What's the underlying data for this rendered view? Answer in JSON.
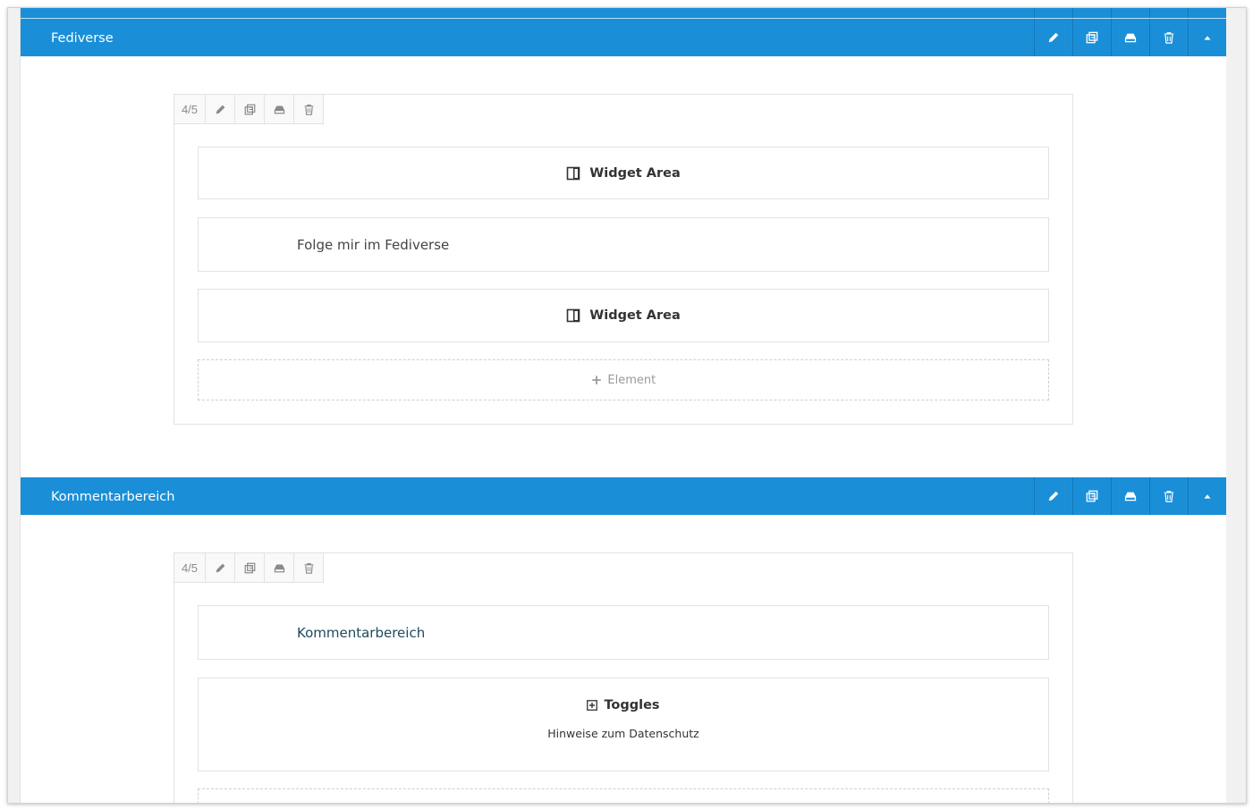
{
  "sections": [
    {
      "title": "Fediverse",
      "column": {
        "size_label": "4/5",
        "elements": [
          {
            "type": "widget-area",
            "label": "Widget Area"
          },
          {
            "type": "text",
            "label": "Folge mir im Fediverse"
          },
          {
            "type": "widget-area",
            "label": "Widget Area"
          }
        ],
        "add_label": "Element"
      }
    },
    {
      "title": "Kommentarbereich",
      "column": {
        "size_label": "4/5",
        "elements": [
          {
            "type": "text",
            "label": "Kommentarbereich"
          },
          {
            "type": "toggles",
            "label": "Toggles",
            "sub": "Hinweise zum Datenschutz"
          }
        ]
      }
    }
  ],
  "icons": {
    "header_controls": [
      "pencil-icon",
      "clone-icon",
      "save-icon",
      "trash-icon",
      "collapse-arrow-icon"
    ],
    "column_controls": [
      "pencil-icon",
      "clone-icon",
      "save-icon",
      "trash-icon"
    ],
    "widget_area": "widget-area-icon",
    "toggles": "toggles-plus-icon",
    "add": "plus-icon"
  },
  "colors": {
    "header_bg": "#1a8fd8",
    "header_text": "#ffffff",
    "border": "#e2e2e2"
  }
}
